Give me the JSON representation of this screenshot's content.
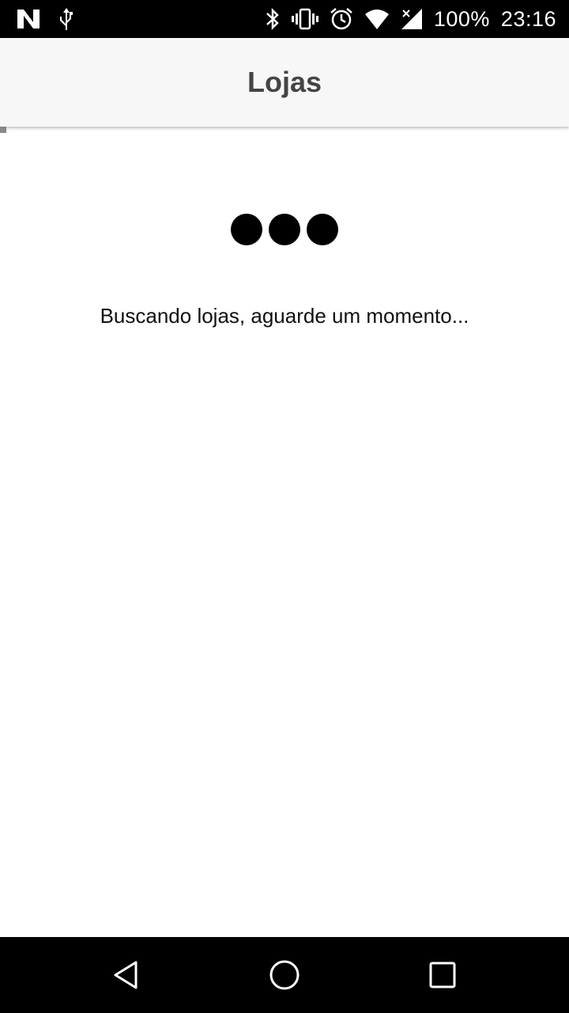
{
  "status_bar": {
    "battery_text": "100%",
    "time": "23:16",
    "icons_left": [
      "n-app-icon",
      "usb-icon"
    ],
    "icons_right": [
      "bluetooth-icon",
      "vibrate-icon",
      "alarm-icon",
      "wifi-icon",
      "signal-icon"
    ]
  },
  "app_bar": {
    "title": "Lojas"
  },
  "loading": {
    "message": "Buscando lojas, aguarde um momento...",
    "indicator": "three-dots"
  },
  "nav_bar": {
    "buttons": [
      "back-icon",
      "home-icon",
      "recents-icon"
    ]
  },
  "colors": {
    "status_bar_bg": "#000000",
    "app_bar_bg": "#f7f7f7",
    "title_color": "#444444",
    "dot_color": "#000000",
    "nav_bar_bg": "#000000"
  }
}
